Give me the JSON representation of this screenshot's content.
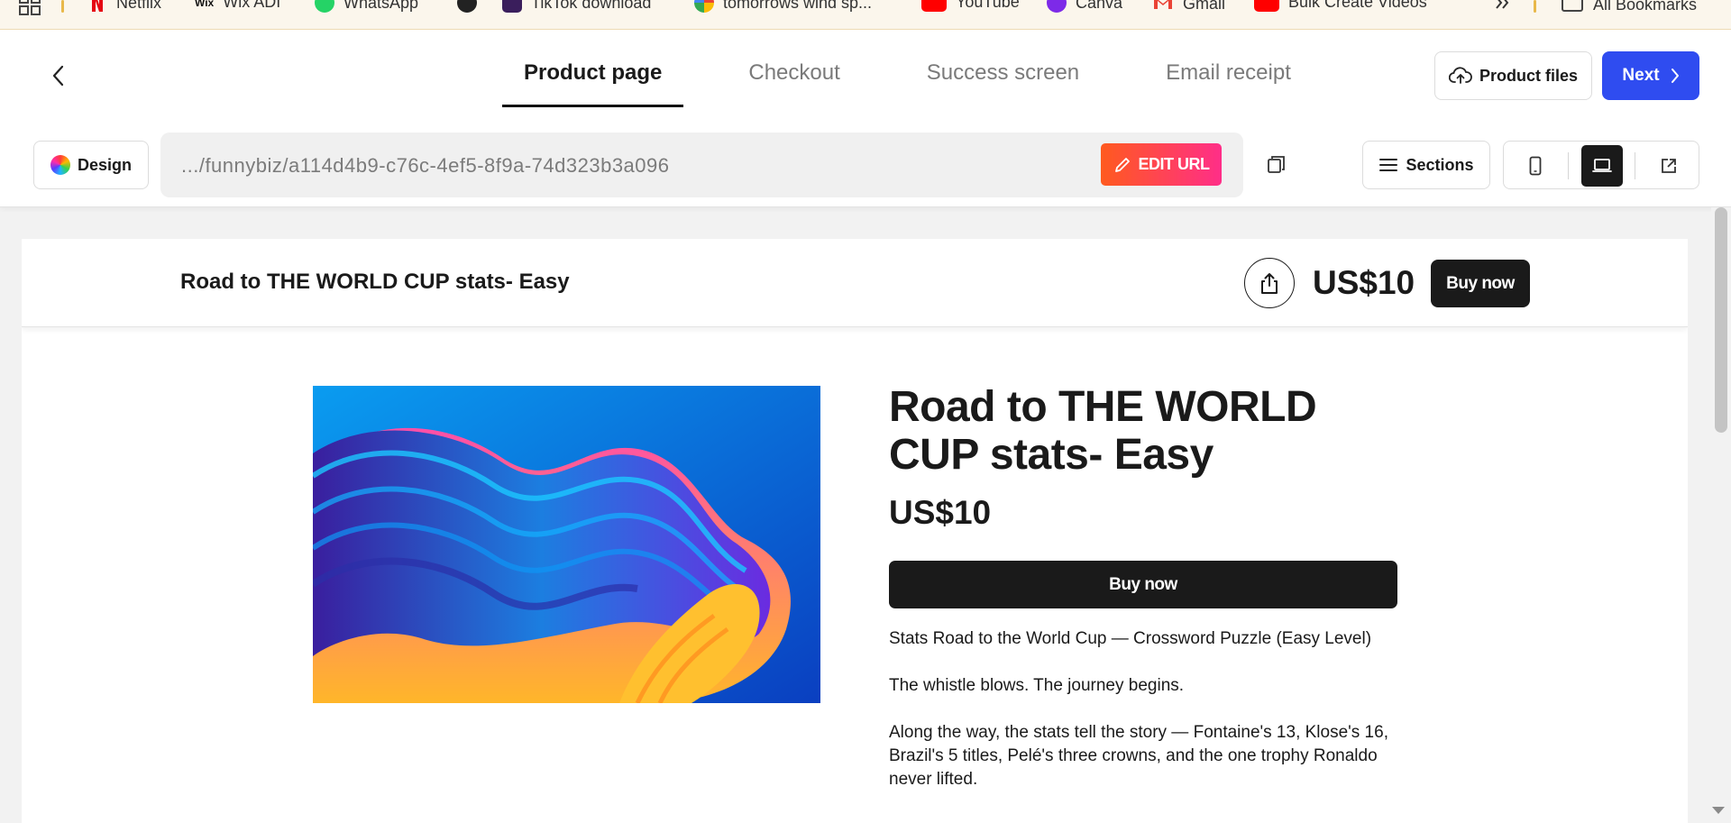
{
  "bookmarks": [
    {
      "label": "",
      "icon": "apps-grid-icon"
    },
    {
      "label": "Netflix",
      "icon": "netflix-icon",
      "color": "#e50914"
    },
    {
      "label": "Wix ADI",
      "icon": "wix-icon",
      "color": "#111111"
    },
    {
      "label": "WhatsApp",
      "icon": "whatsapp-icon",
      "color": "#25d366"
    },
    {
      "label": "",
      "icon": "circle-logo-icon",
      "color": "#222222"
    },
    {
      "label": "TikTok download",
      "icon": "tiktok-icon",
      "color": "#3a1e5c"
    },
    {
      "label": "tomorrows wind sp...",
      "icon": "google-icon",
      "color": "#4285f4"
    },
    {
      "label": "YouTube",
      "icon": "youtube-icon",
      "color": "#ff0000"
    },
    {
      "label": "Canva",
      "icon": "canva-icon",
      "color": "#7d2ae8"
    },
    {
      "label": "Gmail",
      "icon": "gmail-icon",
      "color": "#ea4335"
    },
    {
      "label": "Bulk Create Videos",
      "icon": "youtube-icon",
      "color": "#ff0000"
    },
    {
      "label": "",
      "icon": "more-chevrons-icon"
    },
    {
      "label": "All Bookmarks",
      "icon": "folder-icon"
    }
  ],
  "header": {
    "tabs": [
      {
        "label": "Product page",
        "active": true
      },
      {
        "label": "Checkout",
        "active": false
      },
      {
        "label": "Success screen",
        "active": false
      },
      {
        "label": "Email receipt",
        "active": false
      }
    ],
    "product_files_label": "Product files",
    "next_label": "Next",
    "design_label": "Design",
    "url": ".../funnybiz/a114d4b9-c76c-4ef5-8f9a-74d323b3a096",
    "edit_url_label": "EDIT URL",
    "sections_label": "Sections",
    "accent_color": "#2f4cf0"
  },
  "preview": {
    "sticky_title": "Road to THE WORLD CUP stats- Easy",
    "sticky_price": "US$10",
    "sticky_buy_label": "Buy now",
    "product_title": "Road to THE WORLD CUP stats- Easy",
    "product_price": "US$10",
    "buy_label": "Buy now",
    "description": [
      "Stats Road to the World Cup — Crossword Puzzle (Easy Level)",
      "The whistle blows. The journey begins.",
      "Along the way, the stats tell the story — Fontaine's 13, Klose's 16, Brazil's 5 titles, Pelé's three crowns, and the one trophy Ronaldo never lifted."
    ]
  }
}
